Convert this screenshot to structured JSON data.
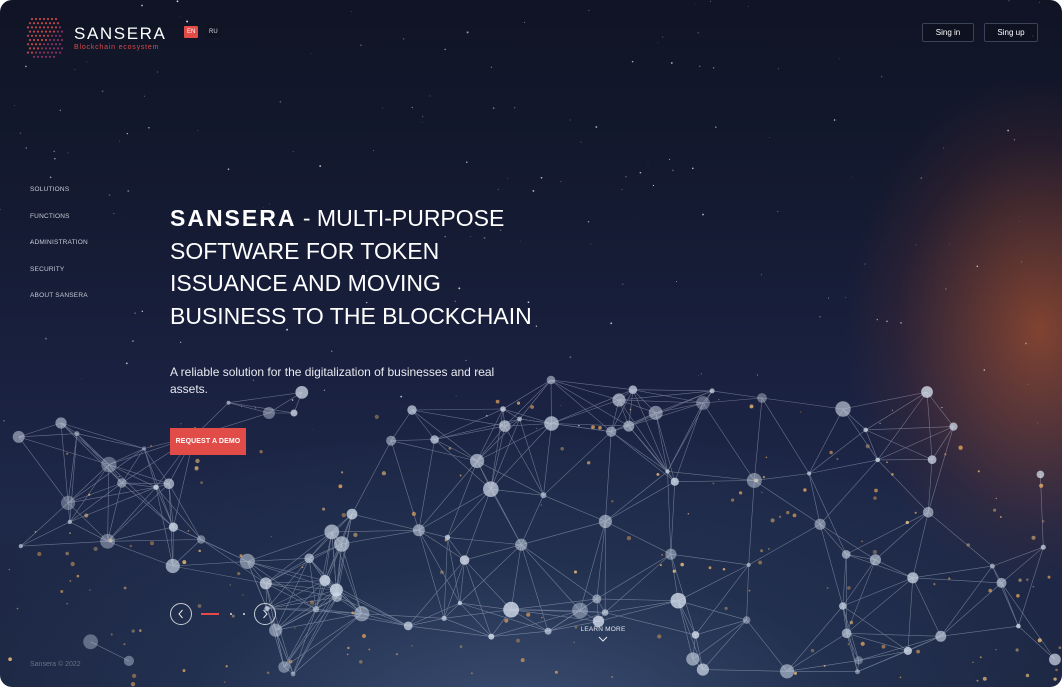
{
  "brand": {
    "name": "SANSERA",
    "tagline": "Blockchain ecosystem",
    "logo_icon": "sansera-dot-logo",
    "accent_color": "#e24c48"
  },
  "header": {
    "languages": [
      {
        "label": "EN",
        "active": true
      },
      {
        "label": "RU",
        "active": false
      }
    ],
    "signin_label": "Sing in",
    "signup_label": "Sing up"
  },
  "sidenav": {
    "items": [
      {
        "label": "SOLUTIONS"
      },
      {
        "label": "FUNCTIONS"
      },
      {
        "label": "ADMINISTRATION"
      },
      {
        "label": "SECURITY"
      },
      {
        "label": "ABOUT SANSERA"
      }
    ]
  },
  "hero": {
    "brand": "SANSERA",
    "separator": " - ",
    "title_line1": "MULTI-PURPOSE",
    "title_line2": "SOFTWARE FOR TOKEN",
    "title_line3": "ISSUANCE AND MOVING",
    "title_line4": "BUSINESS TO THE BLOCKCHAIN",
    "subtitle": "A reliable solution for the digitalization of businesses and real assets.",
    "cta_label": "REQUEST A DEMO"
  },
  "slider": {
    "prev_icon": "chevron-left-icon",
    "next_icon": "chevron-right-icon",
    "active_index": 0,
    "slides": 3
  },
  "learn_more": {
    "label": "LEARN MORE",
    "icon": "chevron-down-icon"
  },
  "footer": {
    "copyright": "Sansera © 2022"
  }
}
